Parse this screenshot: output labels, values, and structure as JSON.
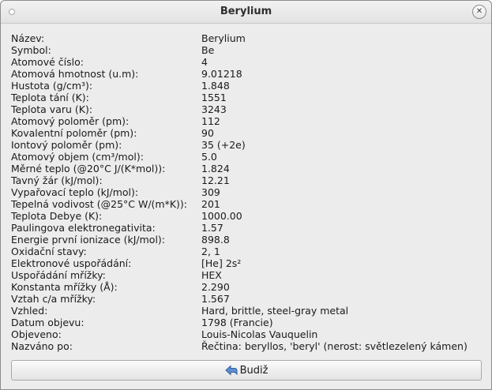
{
  "window": {
    "title": "Berylium"
  },
  "properties": [
    {
      "label": "Název:",
      "value": "Berylium"
    },
    {
      "label": "Symbol:",
      "value": "Be"
    },
    {
      "label": "Atomové číslo:",
      "value": "4"
    },
    {
      "label": "Atomová hmotnost (u.m):",
      "value": "9.01218"
    },
    {
      "label": "Hustota (g/cm³):",
      "value": "1.848"
    },
    {
      "label": "Teplota tání (K):",
      "value": "1551"
    },
    {
      "label": "Teplota varu (K):",
      "value": "3243"
    },
    {
      "label": "Atomový poloměr (pm):",
      "value": "112"
    },
    {
      "label": "Kovalentní poloměr (pm):",
      "value": "90"
    },
    {
      "label": "Iontový poloměr (pm):",
      "value": "35 (+2e)"
    },
    {
      "label": "Atomový objem (cm³/mol):",
      "value": "5.0"
    },
    {
      "label": "Měrné teplo (@20°C J/(K*mol)):",
      "value": "1.824"
    },
    {
      "label": "Tavný žár (kJ/mol):",
      "value": "12.21"
    },
    {
      "label": "Vypařovací teplo (kJ/mol):",
      "value": "309"
    },
    {
      "label": "Tepelná vodivost (@25°C W/(m*K)):",
      "value": "201"
    },
    {
      "label": "Teplota Debye (K):",
      "value": "1000.00"
    },
    {
      "label": "Paulingova elektronegativita:",
      "value": "1.57"
    },
    {
      "label": "Energie první ionizace (kJ/mol):",
      "value": "898.8"
    },
    {
      "label": "Oxidační stavy:",
      "value": "2, 1"
    },
    {
      "label": "Elektronové uspořádání:",
      "value": "[He] 2s²"
    },
    {
      "label": "Uspořádání mřížky:",
      "value": "HEX"
    },
    {
      "label": "Konstanta mřížky (Å):",
      "value": "2.290"
    },
    {
      "label": "Vztah c/a mřížky:",
      "value": "1.567"
    },
    {
      "label": "Vzhled:",
      "value": "Hard, brittle, steel-gray metal"
    },
    {
      "label": "Datum objevu:",
      "value": "1798 (Francie)"
    },
    {
      "label": "Objeveno:",
      "value": "Louis-Nicolas Vauquelin"
    },
    {
      "label": "Nazváno po:",
      "value": "Řečtina: beryllos, 'beryl' (nerost: světlezelený kámen)"
    }
  ],
  "buttons": {
    "ok_label": "Budiž",
    "ok_icon": "back-arrow-icon",
    "close_icon": "close-icon"
  },
  "colors": {
    "icon_blue": "#3b6fb6"
  }
}
